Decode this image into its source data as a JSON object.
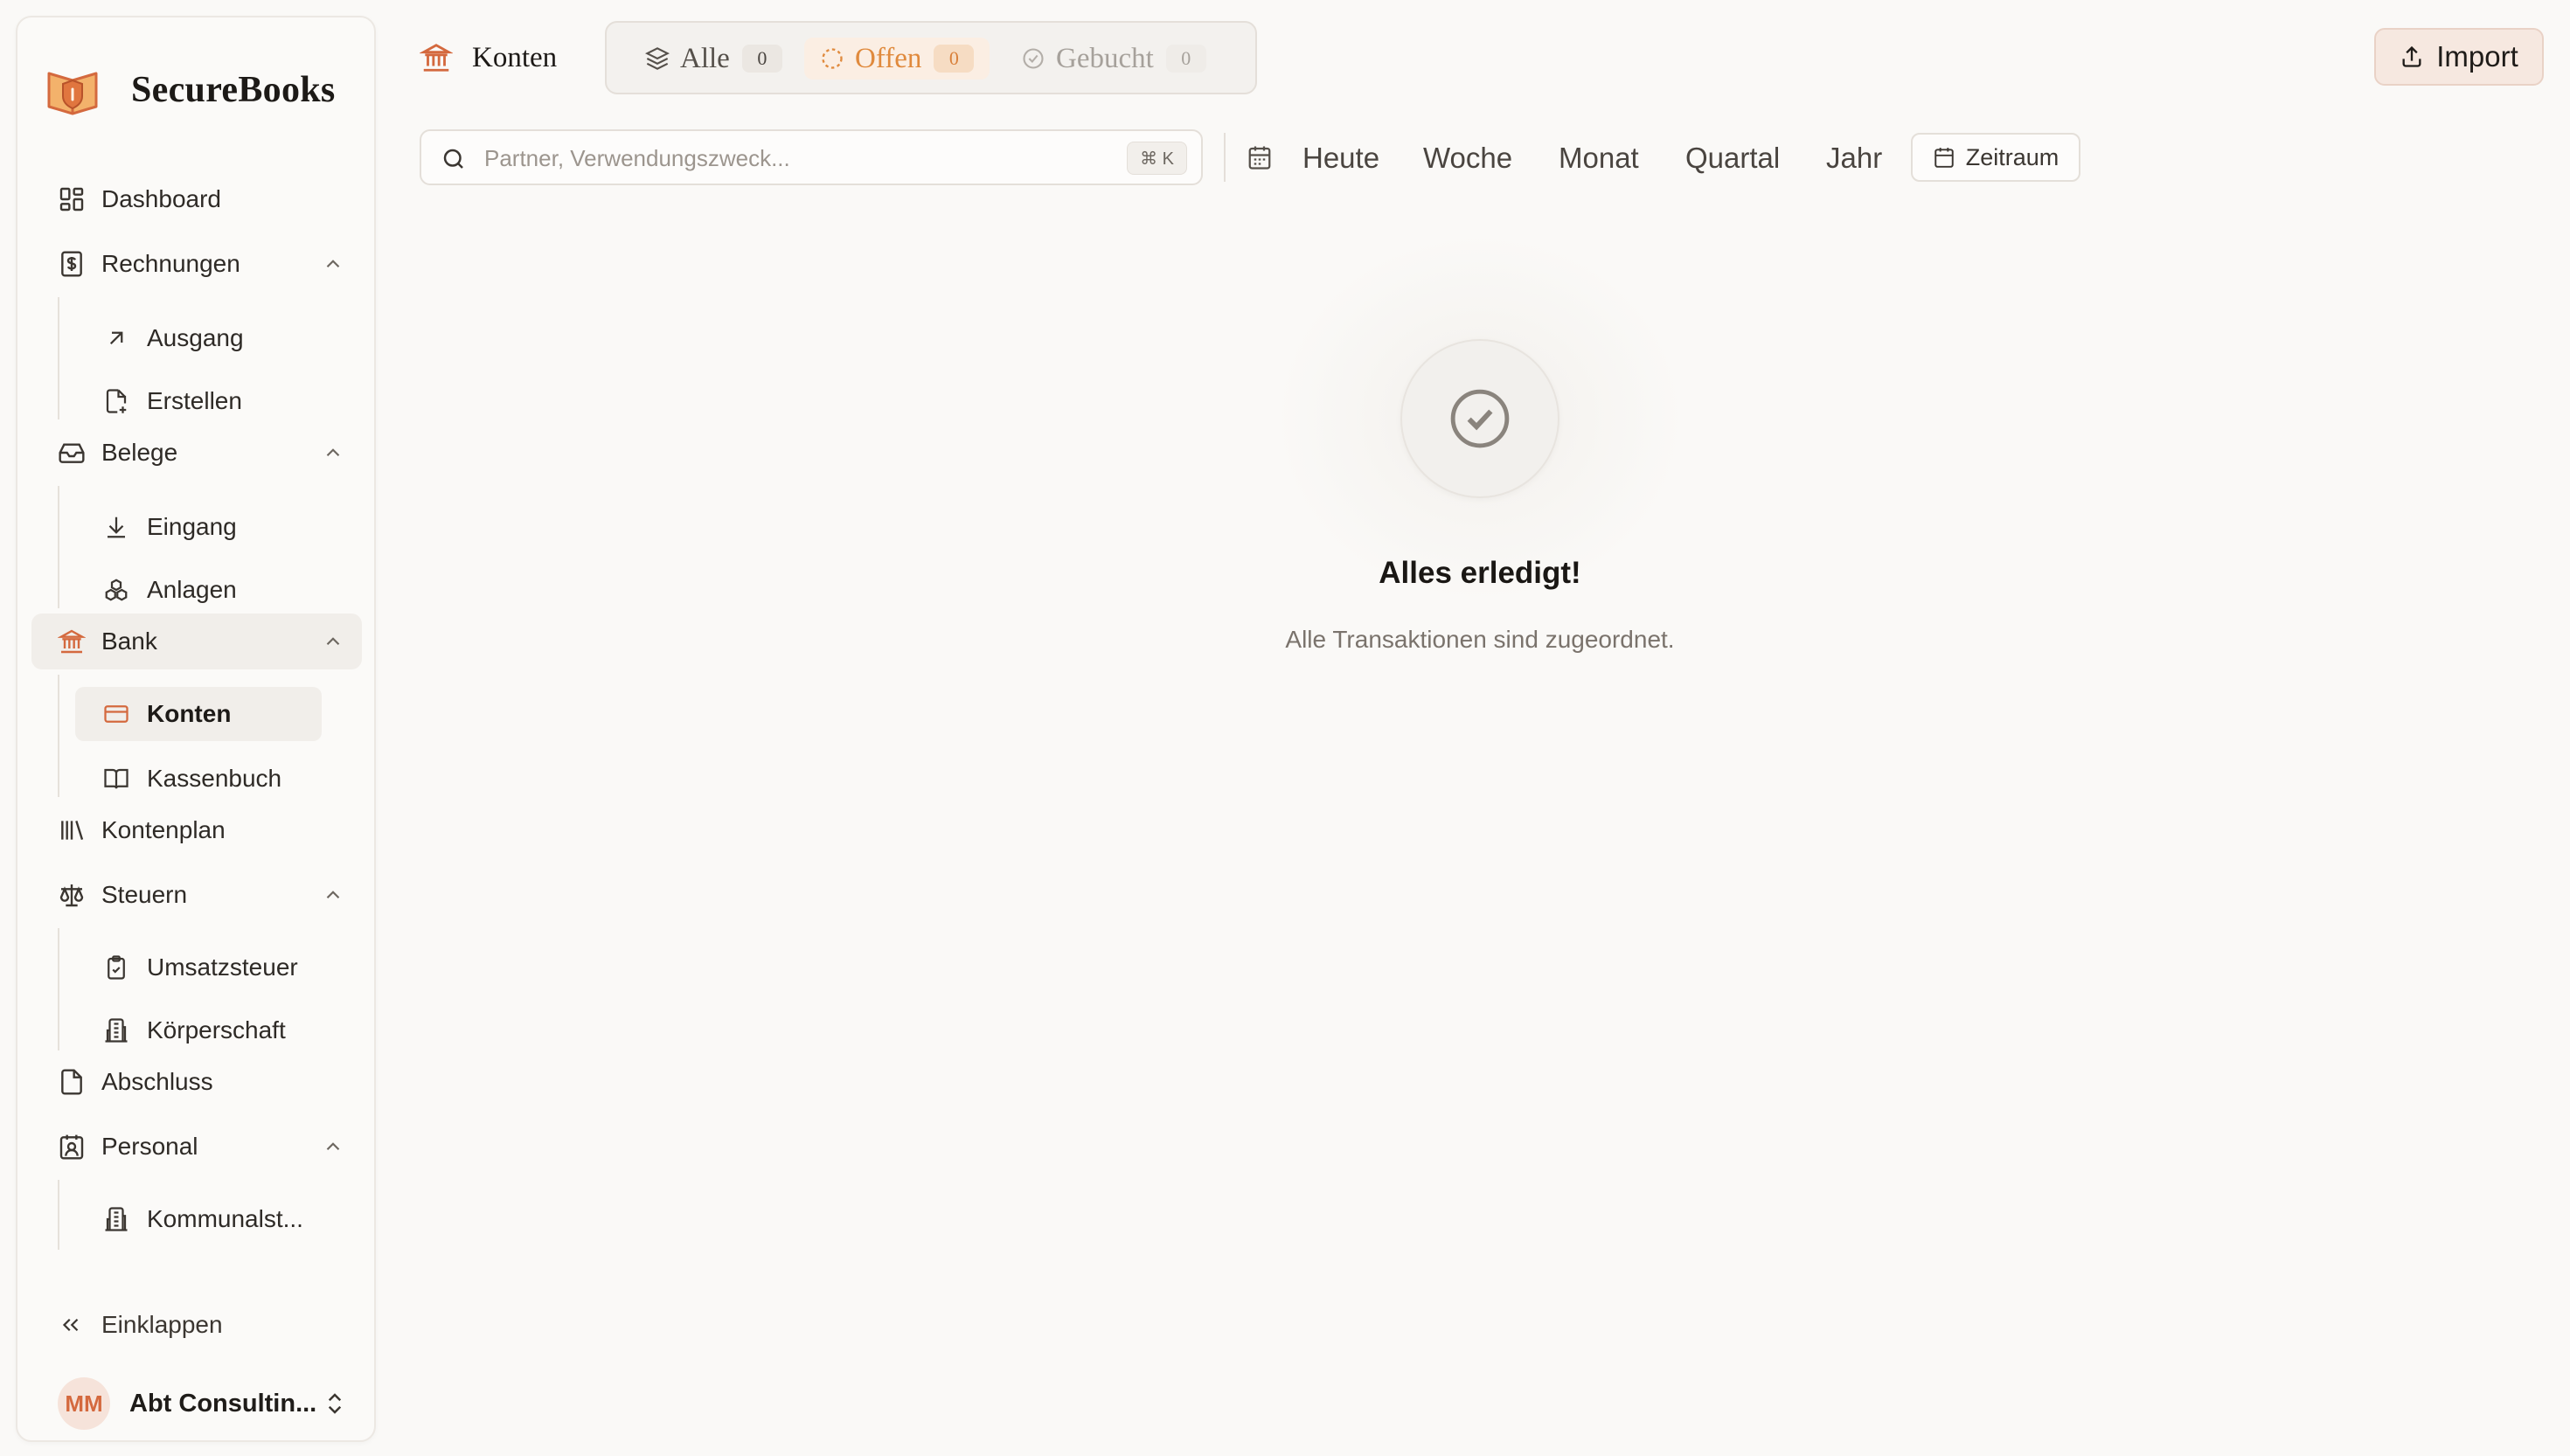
{
  "app": {
    "name": "SecureBooks"
  },
  "sidebar": {
    "dashboard": "Dashboard",
    "rechnungen": "Rechnungen",
    "ausgang": "Ausgang",
    "erstellen": "Erstellen",
    "belege": "Belege",
    "eingang": "Eingang",
    "anlagen": "Anlagen",
    "bank": "Bank",
    "konten": "Konten",
    "kassenbuch": "Kassenbuch",
    "kontenplan": "Kontenplan",
    "steuern": "Steuern",
    "umsatzsteuer": "Umsatzsteuer",
    "koerperschaft": "Körperschaft",
    "abschluss": "Abschluss",
    "personal": "Personal",
    "kommunal": "Kommunalst...",
    "collapse": "Einklappen",
    "account_initials": "MM",
    "account_name": "Abt Consultin..."
  },
  "header": {
    "title": "Konten",
    "tabs": {
      "all": {
        "label": "Alle",
        "count": "0"
      },
      "open": {
        "label": "Offen",
        "count": "0"
      },
      "booked": {
        "label": "Gebucht",
        "count": "0"
      }
    },
    "import": "Import"
  },
  "filters": {
    "search_placeholder": "Partner, Verwendungszweck...",
    "shortcut": "⌘ K",
    "periods": [
      "Heute",
      "Woche",
      "Monat",
      "Quartal",
      "Jahr"
    ],
    "range": "Zeitraum"
  },
  "empty_state": {
    "title": "Alles erledigt!",
    "subtitle": "Alle Transaktionen sind zugeordnet."
  },
  "colors": {
    "accent": "#d4693e",
    "open": "#e08a3d",
    "background": "#faf9f7"
  }
}
